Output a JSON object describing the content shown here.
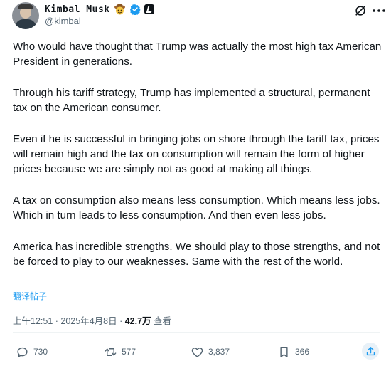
{
  "author": {
    "display_name": "Kimbal Musk",
    "handle": "@kimbal"
  },
  "header_icons": [
    "cowboy-hat-emoji-icon",
    "verified-badge-icon",
    "affiliate-badge-icon",
    "grok-icon",
    "more-options-icon"
  ],
  "tweet": {
    "paragraphs": [
      "Who would have thought that Trump was actually the most high tax American President in generations.",
      "Through his tariff strategy, Trump has implemented a structural, permanent tax on the American consumer.",
      "Even if he is successful in bringing jobs on shore through the tariff tax, prices will remain high and the tax on consumption will remain the form of higher prices because we are simply not as good at making all things.",
      "A tax on consumption also means less consumption. Which means less jobs. Which in turn leads to less consumption. And then even less jobs.",
      "America has incredible strengths. We should play to those strengths, and not be forced to play to our weaknesses. Same with the rest of the world."
    ],
    "translate_label": "翻译帖子"
  },
  "meta": {
    "time": "上午12:51",
    "separator": " · ",
    "date": "2025年4月8日",
    "views_count": "42.7万",
    "views_label": " 查看"
  },
  "actions": {
    "replies": "730",
    "reposts": "577",
    "likes": "3,837",
    "bookmarks": "366"
  },
  "colors": {
    "text": "#0f1419",
    "secondary": "#536471",
    "accent": "#1d9bf0",
    "verified": "#1d9bf0"
  }
}
